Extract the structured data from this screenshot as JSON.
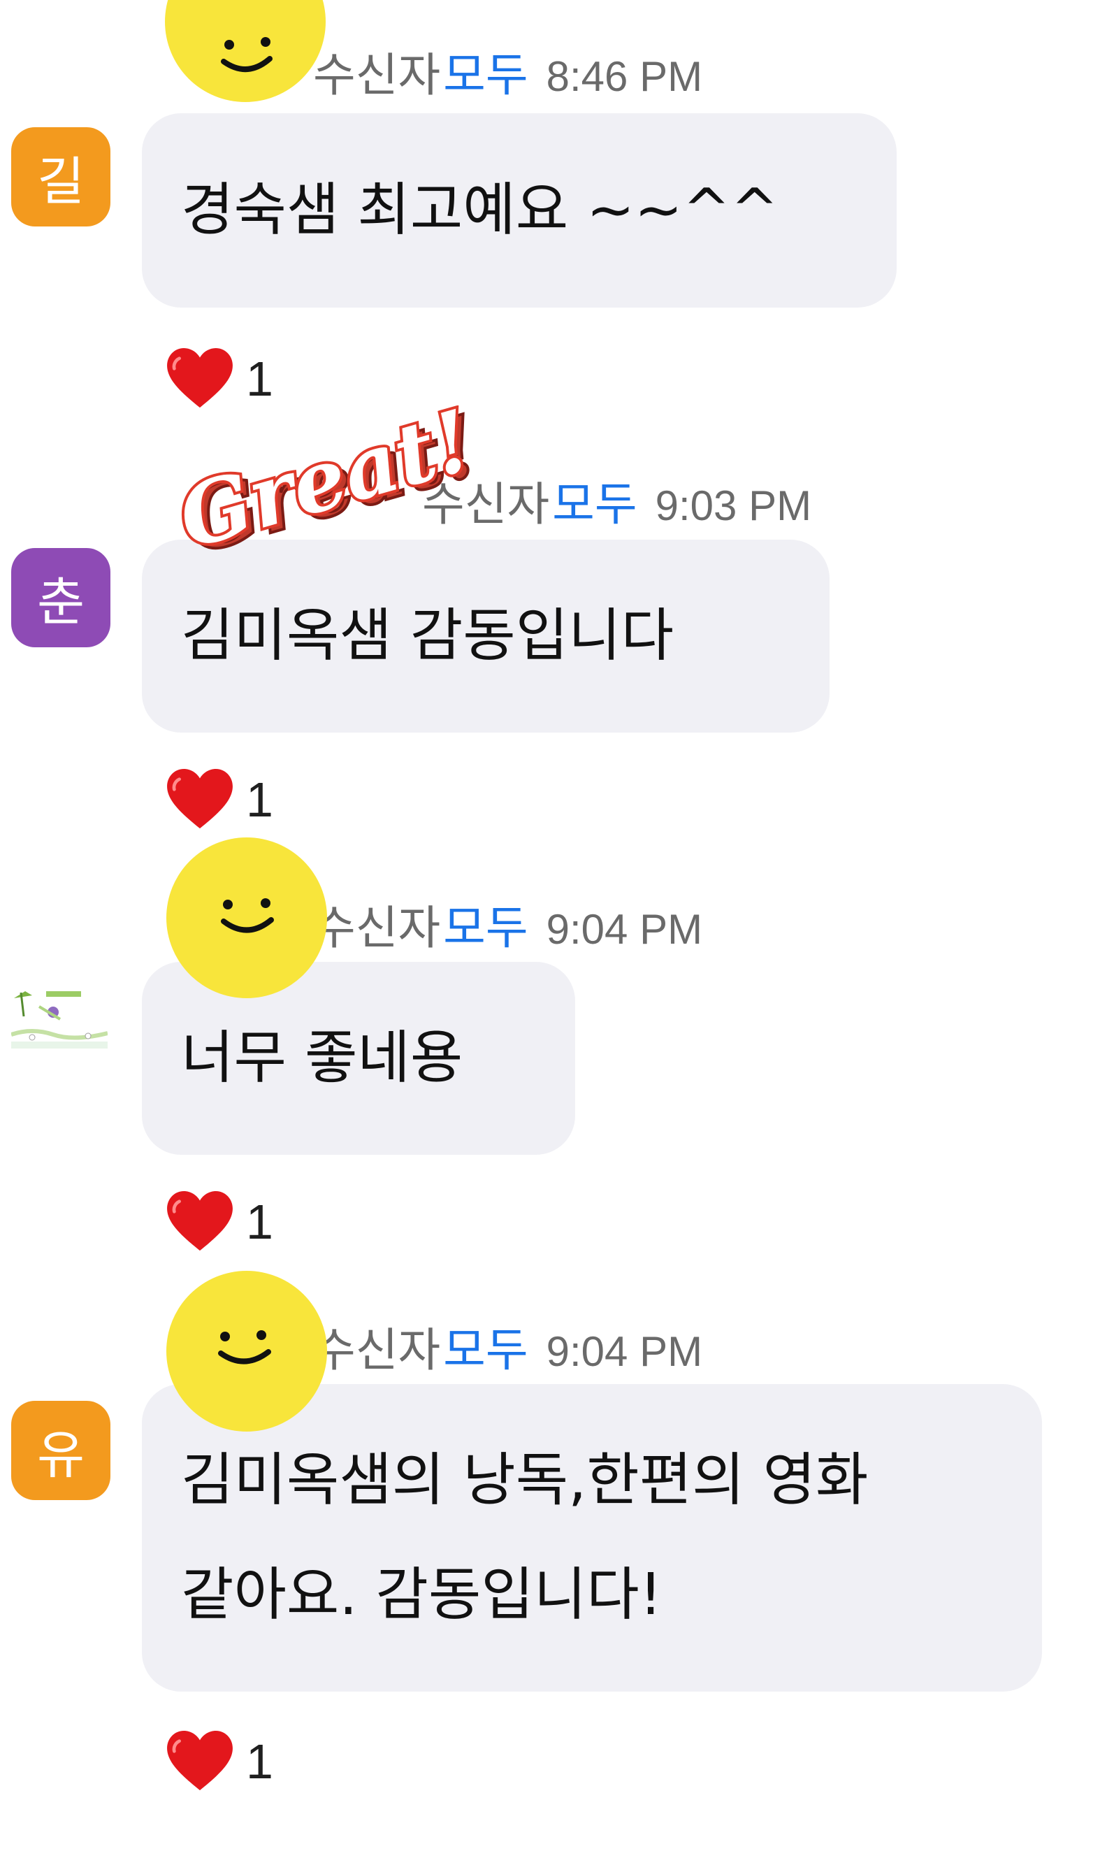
{
  "messages": [
    {
      "to_label": "수신자",
      "all_label": "모두",
      "time": "8:46 PM",
      "avatar_initial": "길",
      "avatar_color": "#f39a1e",
      "text": "경숙샘 최고예요 ~~^^",
      "reaction_count": "1"
    },
    {
      "to_label": "수신자",
      "all_label": "모두",
      "time": "9:03 PM",
      "avatar_initial": "춘",
      "avatar_color": "#8e4bb5",
      "text": "김미옥샘 감동입니다",
      "reaction_count": "1"
    },
    {
      "to_label": "수신자",
      "all_label": "모두",
      "time": "9:04 PM",
      "avatar_initial": "",
      "avatar_color": "#ffffff",
      "text": "너무 좋네용",
      "reaction_count": "1"
    },
    {
      "to_label": "수신자",
      "all_label": "모두",
      "time": "9:04 PM",
      "avatar_initial": "유",
      "avatar_color": "#f39a1e",
      "text": "김미옥샘의 낭독,한편의 영화\n같아요. 감동입니다!",
      "reaction_count": "1"
    }
  ],
  "sticker_text": "Great!",
  "colors": {
    "accent_blue": "#1a73e8",
    "bubble_bg": "#f0f0f5",
    "heart_red": "#e3171c",
    "smiley_yellow": "#f8e53b"
  },
  "icons": [
    "heart-icon",
    "smiley-sticker",
    "great-sticker"
  ]
}
